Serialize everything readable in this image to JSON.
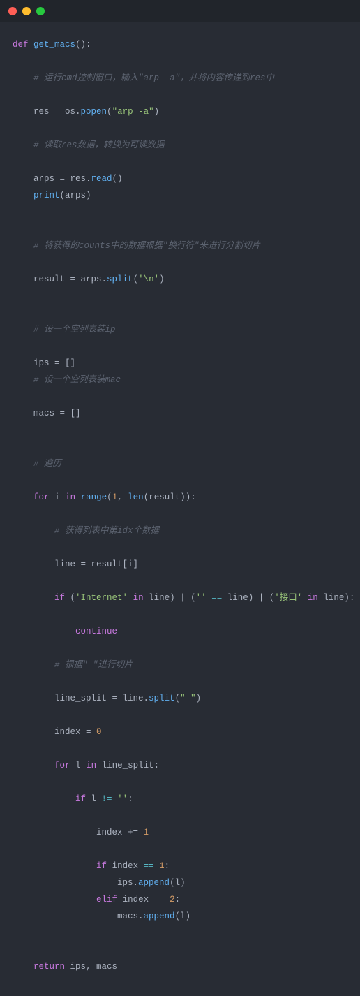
{
  "window_controls": {
    "close": "close",
    "minimize": "minimize",
    "zoom": "zoom"
  },
  "code": {
    "l1_def": "def",
    "l1_fn": "get_macs",
    "l1_paren": "():",
    "cm_run": "# 运行cmd控制窗口，输入\"arp -a\"，并将内容传递到res中",
    "l_res_assign": "res = os.",
    "l_popen": "popen",
    "l_popen_arg": "\"arp -a\"",
    "cm_read": "# 读取res数据，转换为可读数据",
    "l_arps": "arps = res.",
    "l_read": "read",
    "l_read_call": "()",
    "l_print": "print",
    "l_print_arg": "(arps)",
    "cm_counts": "# 将获得的counts中的数据根据\"换行符\"来进行分割切片",
    "l_result": "result = arps.",
    "l_split": "split",
    "l_split_arg": "'\\n'",
    "cm_ips": "# 设一个空列表装ip",
    "l_ips": "ips = []",
    "cm_macs": "# 设一个空列表装mac",
    "l_macs": "macs = []",
    "cm_iter": "# 遍历",
    "l_for": "for",
    "l_i": "i",
    "l_in": "in",
    "l_range": "range",
    "l_range_args_open": "(",
    "l_range_1": "1",
    "l_comma": ", ",
    "l_len": "len",
    "l_range_close": "(result)):",
    "cm_idx": "# 获得列表中第idx个数据",
    "l_line": "line = result[i]",
    "l_if": "if",
    "l_internet": "'Internet'",
    "l_inkw": "in",
    "l_line_ref": "line",
    "l_empty": "''",
    "l_eq": "==",
    "l_iface": "'接口'",
    "l_pipe": " | ",
    "l_continue": "continue",
    "cm_space": "# 根据\" \"进行切片",
    "l_linesplit": "line_split = line.",
    "l_split2": "split",
    "l_space_arg": "\" \"",
    "l_index": "index = ",
    "l_zero": "0",
    "l_for2": "for",
    "l_l": "l",
    "l_in2": "in",
    "l_linesplit_ref": "line_split:",
    "l_if2": "if",
    "l_ne": "!=",
    "l_empty2": "''",
    "l_index_inc": "index += ",
    "l_one": "1",
    "l_if3": "if",
    "l_index_ref": "index",
    "l_eq1": "==",
    "l_1b": "1",
    "l_ips_append": "ips.",
    "l_append": "append",
    "l_l_arg": "(l)",
    "l_elif": "elif",
    "l_index_ref2": "index",
    "l_eq2": "==",
    "l_2": "2",
    "l_macs_append": "macs.",
    "l_return": "return",
    "l_return_vals": "ips, macs"
  }
}
